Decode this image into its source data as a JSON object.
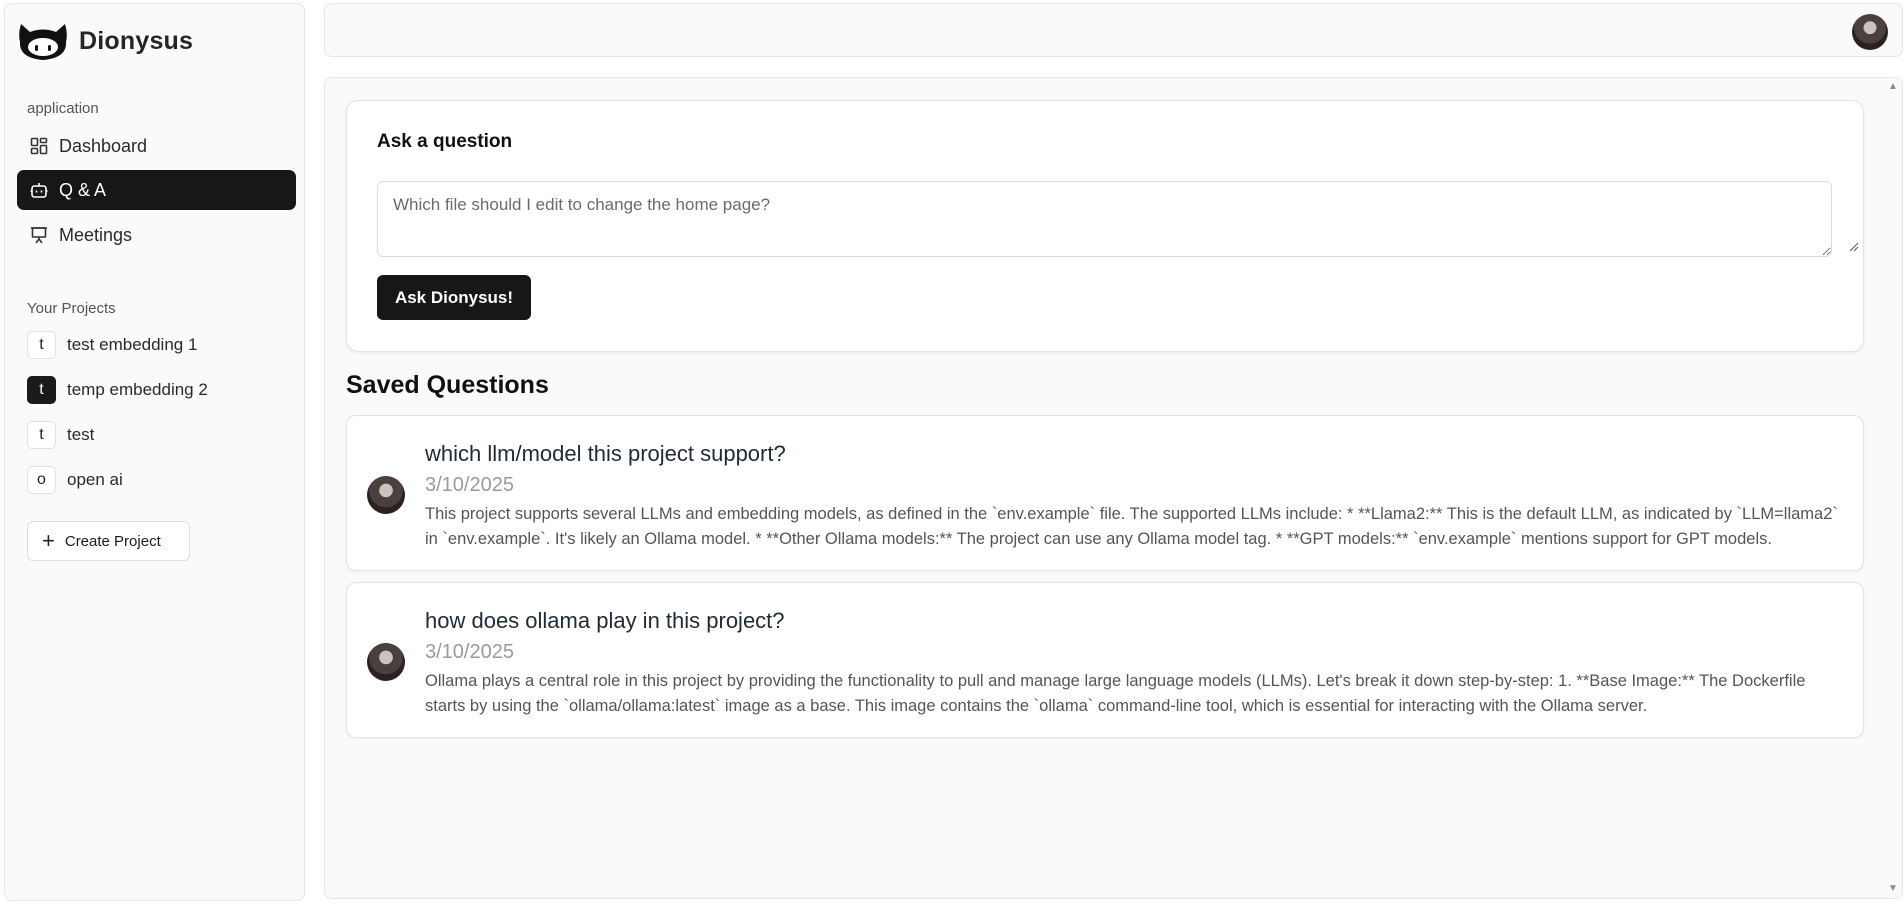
{
  "app": {
    "name": "Dionysus"
  },
  "sidebar": {
    "application_label": "application",
    "nav": [
      {
        "label": "Dashboard",
        "icon": "dashboard-icon",
        "active": false
      },
      {
        "label": "Q & A",
        "icon": "bot-icon",
        "active": true
      },
      {
        "label": "Meetings",
        "icon": "presentation-icon",
        "active": false
      }
    ],
    "projects_label": "Your Projects",
    "projects": [
      {
        "initial": "t",
        "name": "test embedding 1",
        "active": false
      },
      {
        "initial": "t",
        "name": "temp embedding 2",
        "active": true
      },
      {
        "initial": "t",
        "name": "test",
        "active": false
      },
      {
        "initial": "o",
        "name": "open ai",
        "active": false
      }
    ],
    "create_project_label": "Create Project"
  },
  "ask": {
    "title": "Ask a question",
    "placeholder": "Which file should I edit to change the home page?",
    "button_label": "Ask Dionysus!"
  },
  "saved": {
    "title": "Saved Questions",
    "questions": [
      {
        "question": "which llm/model this project support?",
        "date": "3/10/2025",
        "answer": "This project supports several LLMs and embedding models, as defined in the `env.example` file. The supported LLMs include: * **Llama2:** This is the default LLM, as indicated by `LLM=llama2` in `env.example`. It's likely an Ollama model. * **Other Ollama models:** The project can use any Ollama model tag. * **GPT models:** `env.example` mentions support for GPT models."
      },
      {
        "question": "how does ollama play in this project?",
        "date": "3/10/2025",
        "answer": "Ollama plays a central role in this project by providing the functionality to pull and manage large language models (LLMs). Let's break it down step-by-step: 1. **Base Image:** The Dockerfile starts by using the `ollama/ollama:latest` image as a base. This image contains the `ollama` command-line tool, which is essential for interacting with the Ollama server."
      }
    ]
  },
  "colors": {
    "active_bg": "#171717",
    "active_text": "#ffffff",
    "muted": "#9a9a9a"
  }
}
